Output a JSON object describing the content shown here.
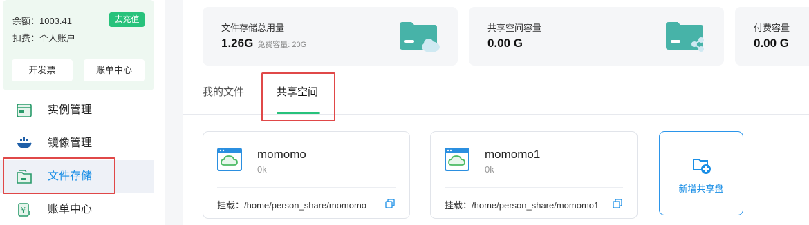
{
  "account": {
    "balance_label": "余额：1003.41",
    "recharge_label": "去充值",
    "payer_label": "扣费：个人账户",
    "invoice_button": "开发票",
    "billing_button": "账单中心"
  },
  "nav": [
    {
      "label": "实例管理",
      "icon": "instance-icon",
      "active": false
    },
    {
      "label": "镜像管理",
      "icon": "docker-whale-icon",
      "active": false
    },
    {
      "label": "文件存储",
      "icon": "file-storage-icon",
      "active": true
    },
    {
      "label": "账单中心",
      "icon": "billing-icon",
      "active": false
    }
  ],
  "stats": [
    {
      "title": "文件存储总用量",
      "value": "1.26G",
      "sub": "免费容量: 20G",
      "icon": "folder-cloud-icon"
    },
    {
      "title": "共享空间容量",
      "value": "0.00 G",
      "icon": "folder-share-icon"
    },
    {
      "title": "付费容量",
      "value": "0.00 G"
    }
  ],
  "tabs": [
    {
      "label": "我的文件",
      "active": false
    },
    {
      "label": "共享空间",
      "active": true
    }
  ],
  "shares": [
    {
      "name": "momomo",
      "size": "0k",
      "mount": "挂载：/home/person_share/momomo"
    },
    {
      "name": "momomo1",
      "size": "0k",
      "mount": "挂载：/home/person_share/momomo1"
    }
  ],
  "new_share_label": "新增共享盘",
  "colors": {
    "accent_green": "#27c27b",
    "accent_blue": "#1b8fe6",
    "highlight_red": "#e04848"
  }
}
